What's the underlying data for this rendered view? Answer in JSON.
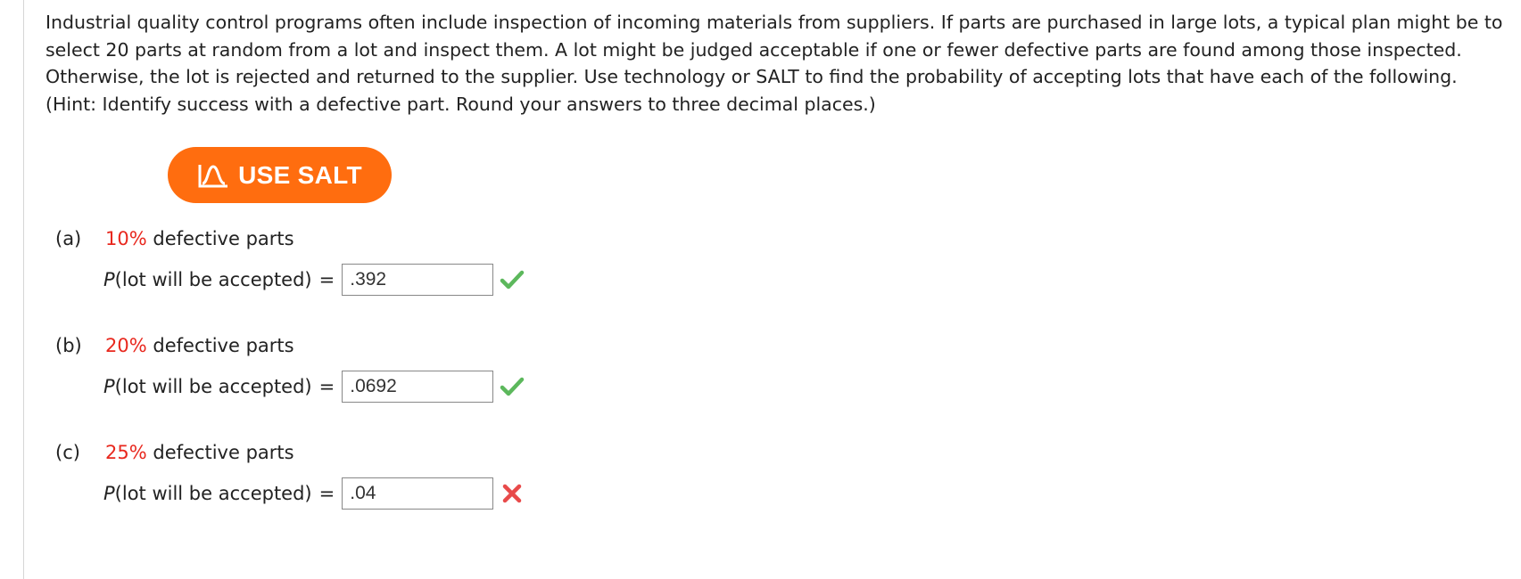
{
  "question": {
    "text": "Industrial quality control programs often include inspection of incoming materials from suppliers. If parts are purchased in large lots, a typical plan might be to select 20 parts at random from a lot and inspect them. A lot might be judged acceptable if one or fewer defective parts are found among those inspected. Otherwise, the lot is rejected and returned to the supplier. Use technology or SALT to find the probability of accepting lots that have each of the following. (Hint: Identify success with a defective part. Round your answers to three decimal places.)"
  },
  "salt_button": {
    "label": "USE SALT",
    "color": "#ff6d0f",
    "icon": "distribution-curve-icon"
  },
  "parts": [
    {
      "letter": "(a)",
      "percent": "10%",
      "description": "defective parts",
      "prob_p": "P",
      "prob_text": "(lot will be accepted)",
      "equals": "=",
      "answer": ".392",
      "status": "correct"
    },
    {
      "letter": "(b)",
      "percent": "20%",
      "description": "defective parts",
      "prob_p": "P",
      "prob_text": "(lot will be accepted)",
      "equals": "=",
      "answer": ".0692",
      "status": "correct"
    },
    {
      "letter": "(c)",
      "percent": "25%",
      "description": "defective parts",
      "prob_p": "P",
      "prob_text": "(lot will be accepted)",
      "equals": "=",
      "answer": ".04",
      "status": "incorrect"
    }
  ],
  "colors": {
    "accent_red": "#e8281e",
    "check_green": "#5cb85c",
    "cross_red": "#e84a4a"
  }
}
